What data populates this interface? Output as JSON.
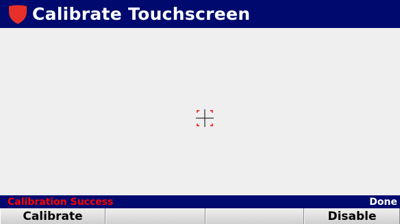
{
  "header": {
    "title": "Calibrate Touchscreen",
    "logo_icon": "red-shield-logo",
    "colors": {
      "bar": "#000a6e",
      "logo": "#e8302a",
      "text": "#ffffff"
    }
  },
  "canvas": {
    "target_icon": "calibration-crosshair-icon",
    "colors": {
      "crosshair": "#000000",
      "corner_marks": "#ff0000"
    }
  },
  "status": {
    "message": "Calibration Success",
    "state": "Done",
    "colors": {
      "message": "#ff0000",
      "state": "#ffffff"
    }
  },
  "softkeys": [
    {
      "label": "Calibrate"
    },
    {
      "label": ""
    },
    {
      "label": ""
    },
    {
      "label": "Disable"
    }
  ]
}
